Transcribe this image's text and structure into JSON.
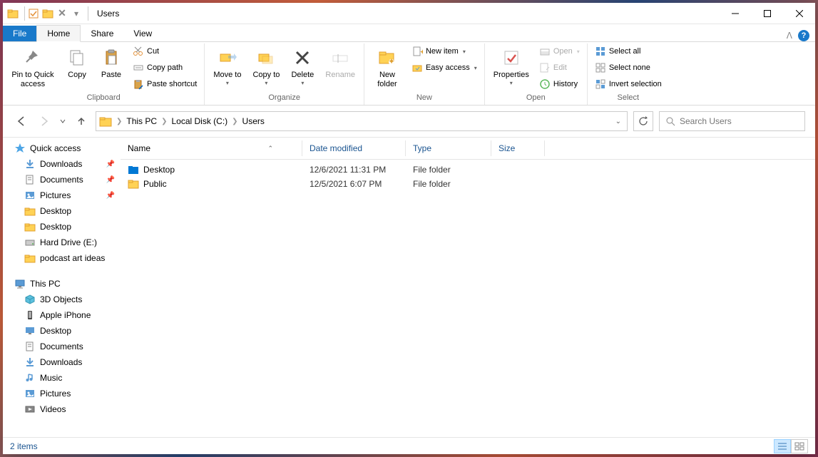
{
  "window": {
    "title": "Users"
  },
  "tabs": {
    "file": "File",
    "home": "Home",
    "share": "Share",
    "view": "View"
  },
  "ribbon": {
    "clipboard": {
      "label": "Clipboard",
      "pin": "Pin to Quick access",
      "copy": "Copy",
      "paste": "Paste",
      "cut": "Cut",
      "copy_path": "Copy path",
      "paste_shortcut": "Paste shortcut"
    },
    "organize": {
      "label": "Organize",
      "move": "Move to",
      "copy": "Copy to",
      "delete": "Delete",
      "rename": "Rename"
    },
    "new_": {
      "label": "New",
      "folder": "New folder",
      "item": "New item",
      "easy": "Easy access"
    },
    "open": {
      "label": "Open",
      "properties": "Properties",
      "open": "Open",
      "edit": "Edit",
      "history": "History"
    },
    "select": {
      "label": "Select",
      "all": "Select all",
      "none": "Select none",
      "invert": "Invert selection"
    }
  },
  "breadcrumb": [
    "This PC",
    "Local Disk (C:)",
    "Users"
  ],
  "search_placeholder": "Search Users",
  "nav_tree": {
    "quick_access": "Quick access",
    "quick_items": [
      {
        "label": "Downloads",
        "pinned": true
      },
      {
        "label": "Documents",
        "pinned": true
      },
      {
        "label": "Pictures",
        "pinned": true
      },
      {
        "label": "Desktop",
        "pinned": false
      },
      {
        "label": "Desktop",
        "pinned": false
      },
      {
        "label": "Hard Drive (E:)",
        "pinned": false
      },
      {
        "label": "podcast art ideas",
        "pinned": false
      }
    ],
    "this_pc": "This PC",
    "pc_items": [
      "3D Objects",
      "Apple iPhone",
      "Desktop",
      "Documents",
      "Downloads",
      "Music",
      "Pictures",
      "Videos"
    ]
  },
  "columns": {
    "name": "Name",
    "date": "Date modified",
    "type": "Type",
    "size": "Size"
  },
  "files": [
    {
      "name": "Desktop",
      "date": "12/6/2021 11:31 PM",
      "type": "File folder",
      "size": "",
      "color": "#0078d4"
    },
    {
      "name": "Public",
      "date": "12/5/2021 6:07 PM",
      "type": "File folder",
      "size": "",
      "color": "#ffd255"
    }
  ],
  "status": "2 items"
}
